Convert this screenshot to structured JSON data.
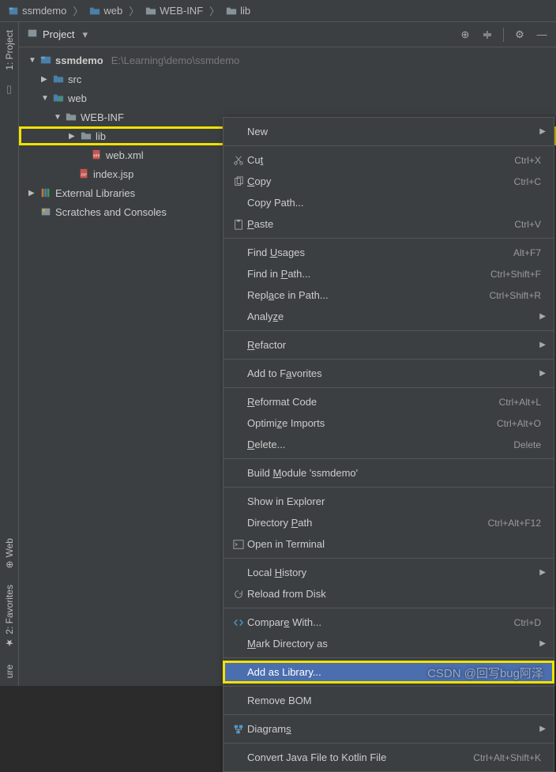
{
  "breadcrumb": [
    {
      "icon": "project",
      "label": "ssmdemo"
    },
    {
      "icon": "folder-blue",
      "label": "web"
    },
    {
      "icon": "folder",
      "label": "WEB-INF"
    },
    {
      "icon": "folder",
      "label": "lib"
    }
  ],
  "panel": {
    "title": "Project",
    "tools": [
      "target",
      "collapse",
      "gear",
      "minimize"
    ]
  },
  "tree": {
    "root": {
      "label": "ssmdemo",
      "path": "E:\\Learning\\demo\\ssmdemo"
    },
    "src": "src",
    "web": "web",
    "webinf": "WEB-INF",
    "lib": "lib",
    "webxml": "web.xml",
    "indexjsp": "index.jsp",
    "extlib": "External Libraries",
    "scratches": "Scratches and Consoles"
  },
  "gutter": {
    "project": "1: Project",
    "web": "Web",
    "favorites": "2: Favorites",
    "structure": "ure"
  },
  "context_menu": [
    {
      "type": "item",
      "label": "New",
      "submenu": true
    },
    {
      "type": "sep"
    },
    {
      "type": "item",
      "icon": "cut",
      "label_html": "Cu<u>t</u>",
      "shortcut": "Ctrl+X"
    },
    {
      "type": "item",
      "icon": "copy",
      "label_html": "<u>C</u>opy",
      "shortcut": "Ctrl+C"
    },
    {
      "type": "item",
      "label": "Copy Path..."
    },
    {
      "type": "item",
      "icon": "paste",
      "label_html": "<u>P</u>aste",
      "shortcut": "Ctrl+V"
    },
    {
      "type": "sep"
    },
    {
      "type": "item",
      "label_html": "Find <u>U</u>sages",
      "shortcut": "Alt+F7"
    },
    {
      "type": "item",
      "label_html": "Find in <u>P</u>ath...",
      "shortcut": "Ctrl+Shift+F"
    },
    {
      "type": "item",
      "label_html": "Repl<u>a</u>ce in Path...",
      "shortcut": "Ctrl+Shift+R"
    },
    {
      "type": "item",
      "label_html": "Analy<u>z</u>e",
      "submenu": true
    },
    {
      "type": "sep"
    },
    {
      "type": "item",
      "label_html": "<u>R</u>efactor",
      "submenu": true
    },
    {
      "type": "sep"
    },
    {
      "type": "item",
      "label_html": "Add to F<u>a</u>vorites",
      "submenu": true
    },
    {
      "type": "sep"
    },
    {
      "type": "item",
      "label_html": "<u>R</u>eformat Code",
      "shortcut": "Ctrl+Alt+L"
    },
    {
      "type": "item",
      "label_html": "Optimi<u>z</u>e Imports",
      "shortcut": "Ctrl+Alt+O"
    },
    {
      "type": "item",
      "label_html": "<u>D</u>elete...",
      "shortcut": "Delete"
    },
    {
      "type": "sep"
    },
    {
      "type": "item",
      "label_html": "Build <u>M</u>odule 'ssmdemo'"
    },
    {
      "type": "sep"
    },
    {
      "type": "item",
      "label": "Show in Explorer"
    },
    {
      "type": "item",
      "label_html": "Directory <u>P</u>ath",
      "shortcut": "Ctrl+Alt+F12"
    },
    {
      "type": "item",
      "icon": "terminal",
      "label": "Open in Terminal"
    },
    {
      "type": "sep"
    },
    {
      "type": "item",
      "label_html": "Local <u>H</u>istory",
      "submenu": true
    },
    {
      "type": "item",
      "icon": "reload",
      "label": "Reload from Disk"
    },
    {
      "type": "sep"
    },
    {
      "type": "item",
      "icon": "compare",
      "label_html": "Compar<u>e</u> With...",
      "shortcut": "Ctrl+D"
    },
    {
      "type": "item",
      "label_html": "<u>M</u>ark Directory as",
      "submenu": true
    },
    {
      "type": "sep"
    },
    {
      "type": "item",
      "label": "Add as Library...",
      "highlighted": true,
      "hover": true
    },
    {
      "type": "sep"
    },
    {
      "type": "item",
      "label": "Remove BOM"
    },
    {
      "type": "sep"
    },
    {
      "type": "item",
      "icon": "diagrams",
      "label_html": "Diagram<u>s</u>",
      "submenu": true
    },
    {
      "type": "sep"
    },
    {
      "type": "item",
      "label_html": "Convert Java File to Kotlin File",
      "shortcut": "Ctrl+Alt+Shift+K"
    }
  ],
  "watermark": "CSDN @回写bug阿泽"
}
